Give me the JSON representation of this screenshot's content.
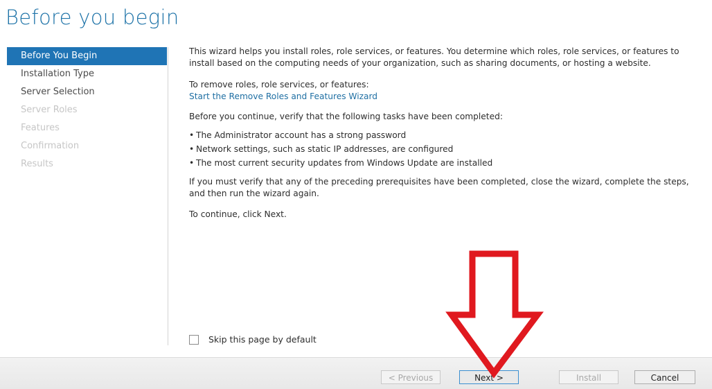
{
  "page": {
    "title": "Before you begin"
  },
  "nav": {
    "items": [
      {
        "label": "Before You Begin",
        "state": "active"
      },
      {
        "label": "Installation Type",
        "state": "normal"
      },
      {
        "label": "Server Selection",
        "state": "normal"
      },
      {
        "label": "Server Roles",
        "state": "disabled"
      },
      {
        "label": "Features",
        "state": "disabled"
      },
      {
        "label": "Confirmation",
        "state": "disabled"
      },
      {
        "label": "Results",
        "state": "disabled"
      }
    ]
  },
  "content": {
    "intro": "This wizard helps you install roles, role services, or features. You determine which roles, role services, or features to install based on the computing needs of your organization, such as sharing documents, or hosting a website.",
    "remove_label": "To remove roles, role services, or features:",
    "remove_link": "Start the Remove Roles and Features Wizard",
    "verify_heading": "Before you continue, verify that the following tasks have been completed:",
    "tasks": [
      "The Administrator account has a strong password",
      "Network settings, such as static IP addresses, are configured",
      "The most current security updates from Windows Update are installed"
    ],
    "prereq_note": "If you must verify that any of the preceding prerequisites have been completed, close the wizard, complete the steps, and then run the wizard again.",
    "continue_note": "To continue, click Next."
  },
  "skip": {
    "label": "Skip this page by default",
    "checked": false
  },
  "buttons": {
    "previous": "< Previous",
    "next": "Next >",
    "install": "Install",
    "cancel": "Cancel"
  },
  "colors": {
    "accent": "#1f74b5",
    "title": "#1e73a8",
    "link": "#1f6fa3",
    "annotation_arrow": "#e0191f"
  }
}
